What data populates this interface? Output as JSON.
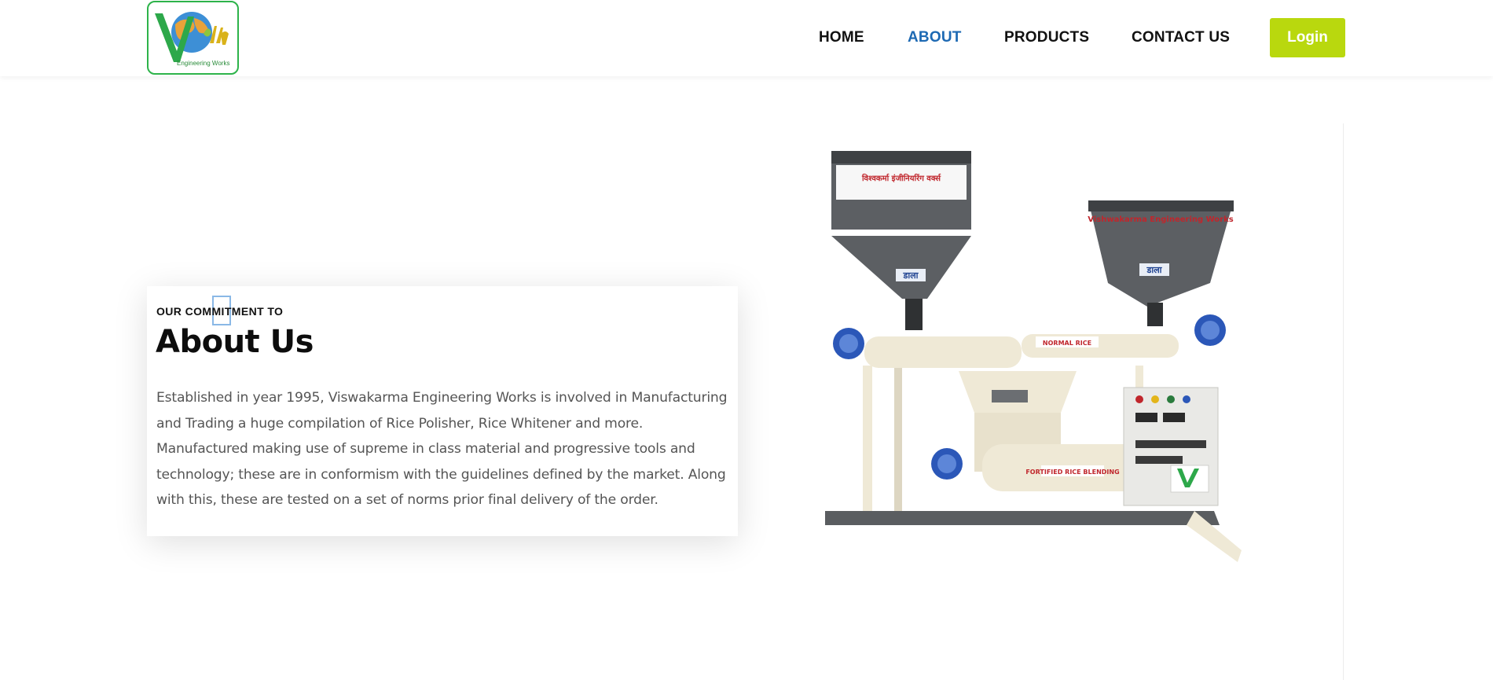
{
  "header": {
    "logo_caption": "Engineering Works",
    "nav": [
      {
        "label": "HOME"
      },
      {
        "label": "ABOUT",
        "active": true
      },
      {
        "label": "PRODUCTS"
      },
      {
        "label": "CONTACT US"
      }
    ],
    "login_label": "Login"
  },
  "colors": {
    "accent_blue": "#1d69b3",
    "login_green": "#b9d80e",
    "logo_border": "#2db34a"
  },
  "about": {
    "eyebrow": "OUR COMMITMENT TO",
    "title": "About Us",
    "description": "Established in year 1995, Viswakarma Engineering Works is involved in Manufacturing and Trading a huge compilation of Rice Polisher, Rice Whitener and more. Manufactured making use of supreme in class material and progressive tools and technology; these are in conformism with the guidelines defined by the market. Along with this, these are tested on a set of norms prior final delivery of the order."
  },
  "machine_image": {
    "hopper_left_label": "डाला",
    "hopper_right_label": "डाला",
    "brand_banner": "Vishwakarma Engineering Works",
    "sign_left_title": "विश्वकर्मा इंजीनियरिंग वर्क्स",
    "pipe_label_1": "NORMAL RICE",
    "pipe_label_2": "FORTIFIED RICE BLENDING"
  }
}
